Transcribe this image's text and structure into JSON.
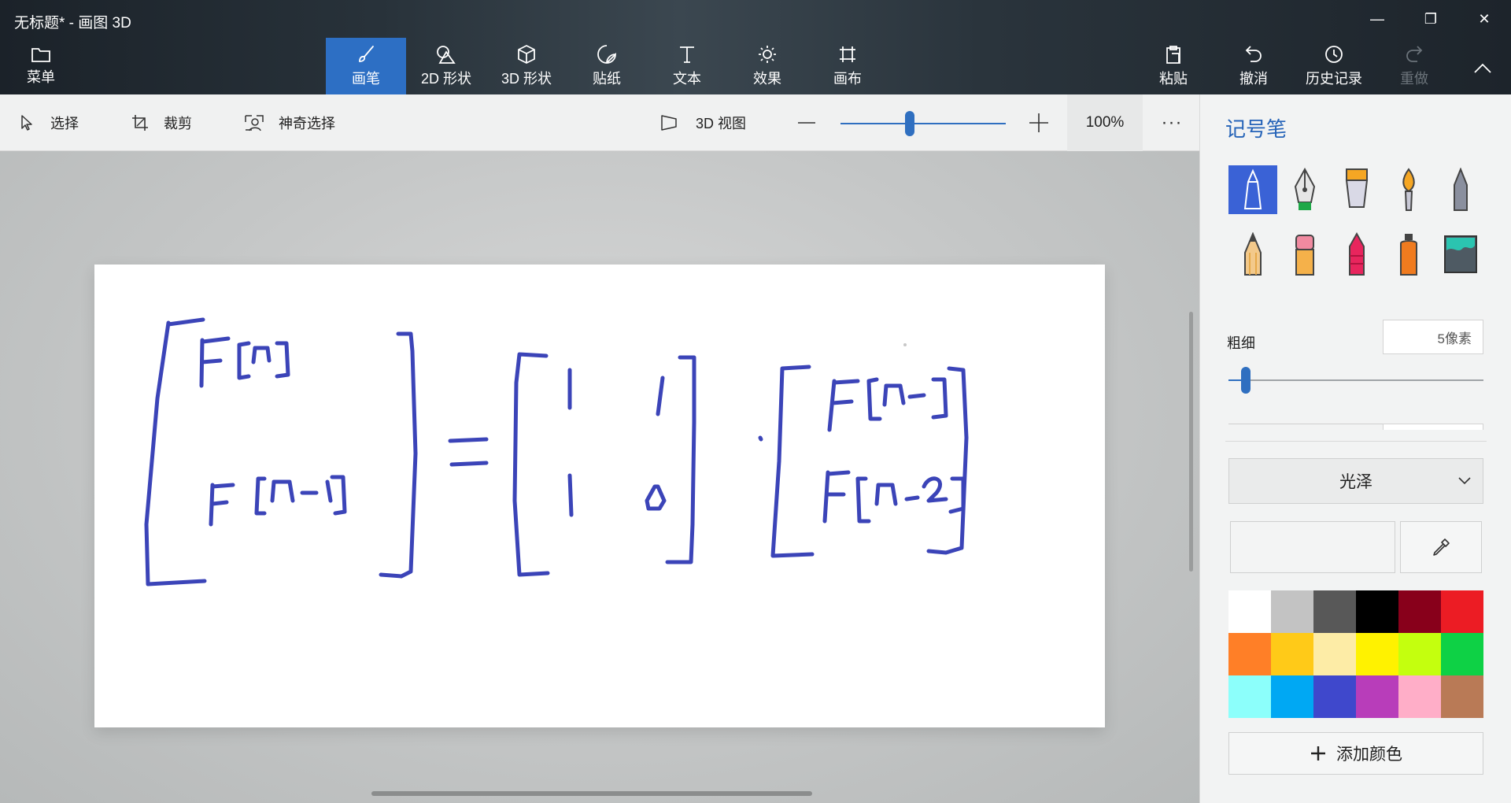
{
  "window": {
    "title": "无标题* - 画图 3D",
    "minimize_glyph": "—",
    "maximize_glyph": "❐",
    "close_glyph": "✕"
  },
  "menu": {
    "label": "菜单",
    "icon": "folder-icon"
  },
  "tools": [
    {
      "label": "画笔",
      "icon": "brush-icon",
      "active": true
    },
    {
      "label": "2D 形状",
      "icon": "shapes-2d-icon",
      "active": false
    },
    {
      "label": "3D 形状",
      "icon": "cube-icon",
      "active": false
    },
    {
      "label": "贴纸",
      "icon": "sticker-icon",
      "active": false
    },
    {
      "label": "文本",
      "icon": "text-icon",
      "active": false
    },
    {
      "label": "效果",
      "icon": "sun-icon",
      "active": false
    },
    {
      "label": "画布",
      "icon": "canvas-icon",
      "active": false
    }
  ],
  "right_tools": [
    {
      "label": "粘贴",
      "icon": "paste-icon",
      "enabled": true
    },
    {
      "label": "撤消",
      "icon": "undo-icon",
      "enabled": true
    },
    {
      "label": "历史记录",
      "icon": "history-icon",
      "enabled": true
    },
    {
      "label": "重做",
      "icon": "redo-icon",
      "enabled": false
    }
  ],
  "subbar": {
    "select": "选择",
    "crop": "裁剪",
    "magic_select": "神奇选择",
    "view_3d": "3D 视图",
    "zoom_level": "100%",
    "zoom_fraction": 0.42,
    "more": "···"
  },
  "panel": {
    "title": "记号笔",
    "brushes": [
      {
        "name": "marker",
        "selected": true
      },
      {
        "name": "calligraphy-pen",
        "selected": false
      },
      {
        "name": "oil-brush",
        "selected": false
      },
      {
        "name": "watercolor",
        "selected": false
      },
      {
        "name": "pixel-pen",
        "selected": false
      },
      {
        "name": "pencil",
        "selected": false
      },
      {
        "name": "eraser",
        "selected": false
      },
      {
        "name": "crayon",
        "selected": false
      },
      {
        "name": "spray-can",
        "selected": false
      },
      {
        "name": "fill",
        "selected": false
      }
    ],
    "thickness_label": "粗细",
    "thickness_value": "5像素",
    "thickness_fraction": 0.05,
    "finish": "光泽",
    "add_color": "添加颜色",
    "palette": [
      "#ffffff",
      "#c3c3c3",
      "#585858",
      "#000000",
      "#88001b",
      "#ec1c24",
      "#ff7f27",
      "#ffca18",
      "#fdeca6",
      "#fff200",
      "#c4ff0e",
      "#0ed145",
      "#8cfffb",
      "#00a8f3",
      "#3f48cc",
      "#b83dba",
      "#ffaec8",
      "#b97a56"
    ]
  },
  "colors": {
    "accent": "#2d6fc4",
    "ink": "#3b44b8"
  }
}
